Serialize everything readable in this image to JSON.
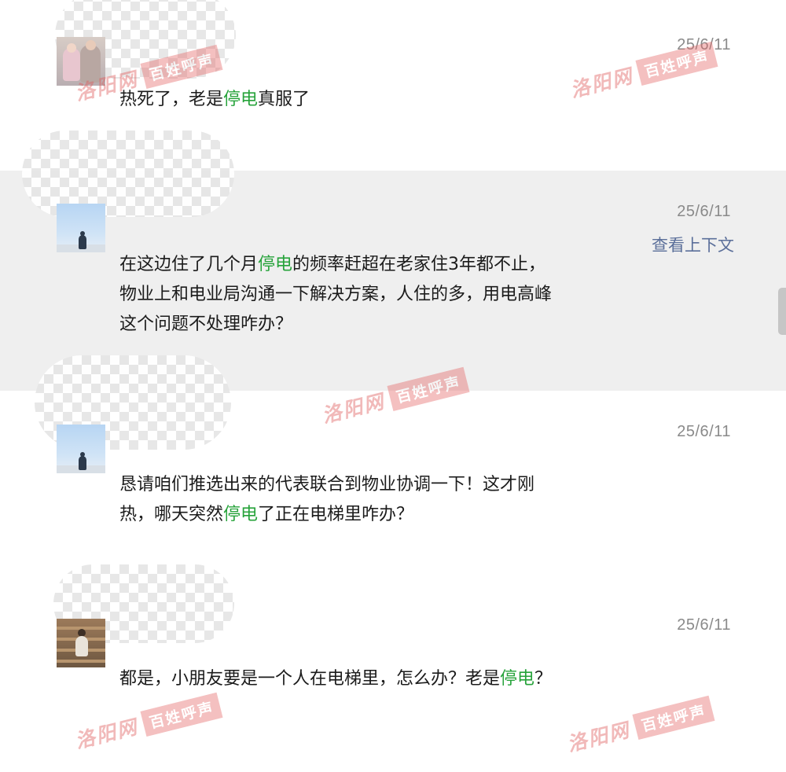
{
  "comments": [
    {
      "timestamp": "25/6/11",
      "text_parts": [
        "热死了，老是",
        "停电",
        "真服了"
      ],
      "avatar": "family-photo-avatar"
    },
    {
      "timestamp": "25/6/11",
      "context_link": "查看上下文",
      "lines": [
        [
          "在这边住了几个月",
          "停电",
          "的频率赶超在老家住3年都不止，"
        ],
        [
          "物业上和电业局沟通一下解决方案，人住的多，用电高峰"
        ],
        [
          "这个问题不处理咋办？"
        ]
      ],
      "avatar": "sky-person-avatar"
    },
    {
      "timestamp": "25/6/11",
      "lines": [
        [
          "恳请咱们推选出来的代表联合到物业协调一下！这才刚"
        ],
        [
          "热，哪天突然",
          "停电",
          "了正在电梯里咋办？"
        ]
      ],
      "avatar": "sky-person-avatar"
    },
    {
      "timestamp": "25/6/11",
      "text_parts": [
        "都是，小朋友要是一个人在电梯里，怎么办？老是",
        "停电",
        "？"
      ],
      "avatar": "street-child-avatar"
    }
  ],
  "watermark": {
    "script": "洛阳网",
    "box": "百姓呼声"
  },
  "colors": {
    "keyword": "#27a33b",
    "link": "#5b6f9a",
    "timestamp": "#8a8a8a",
    "highlight_band": "#efefef",
    "watermark": "#e05a5a"
  }
}
